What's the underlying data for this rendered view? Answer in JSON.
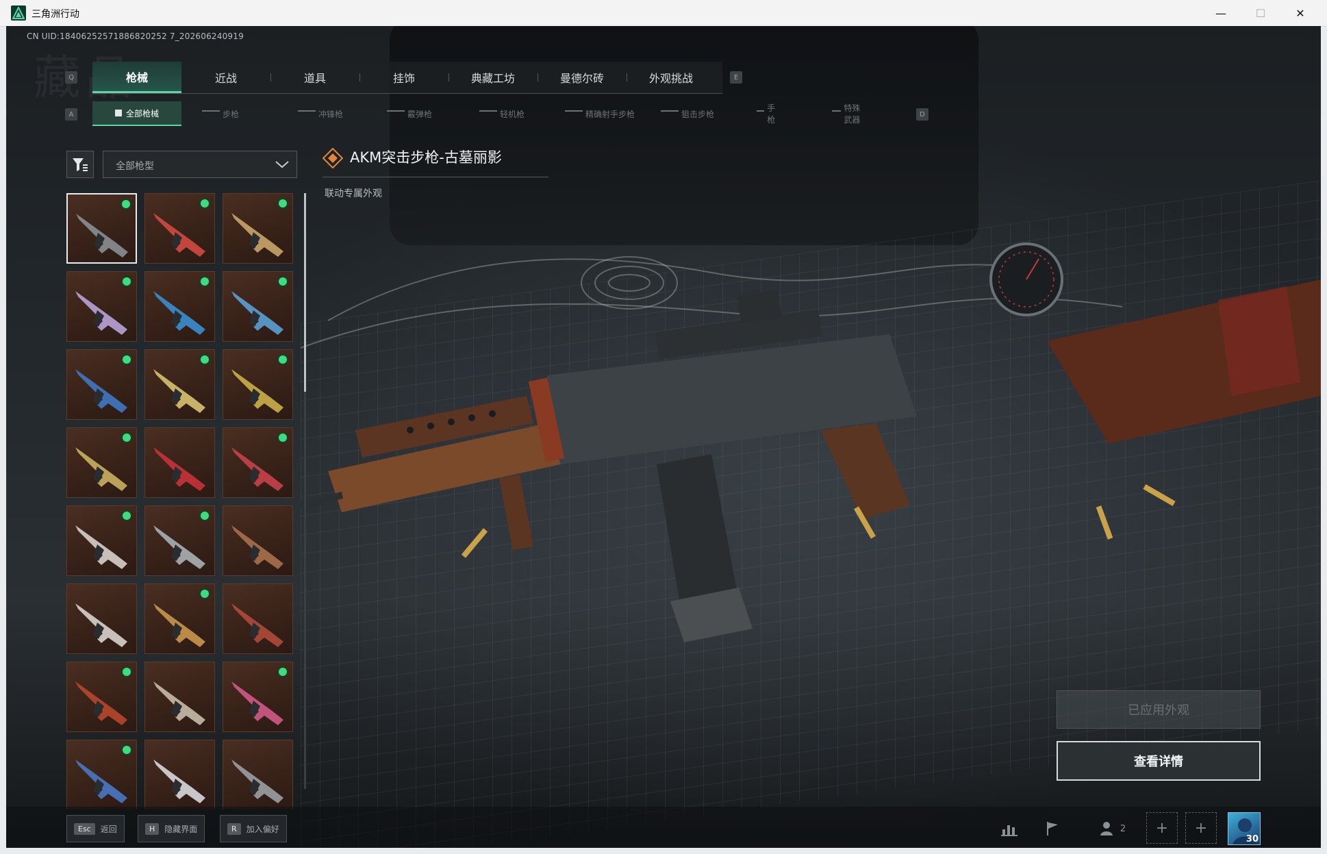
{
  "window": {
    "title": "三角洲行动",
    "min_glyph": "—",
    "max_glyph": "☐",
    "close_glyph": "✕"
  },
  "uid": "CN UID:18406252571886820252 7_202606240919",
  "key_hints": {
    "tab_left": "Q",
    "tab_right": "E",
    "subtab_left": "A",
    "subtab_right": "D"
  },
  "tabs": [
    {
      "label": "枪械",
      "active": true
    },
    {
      "label": "近战"
    },
    {
      "label": "道具"
    },
    {
      "label": "挂饰"
    },
    {
      "label": "典藏工坊"
    },
    {
      "label": "曼德尔砖"
    },
    {
      "label": "外观挑战"
    }
  ],
  "subtabs": [
    {
      "label": "全部枪械",
      "active": true
    },
    {
      "label": "步枪"
    },
    {
      "label": "冲锋枪"
    },
    {
      "label": "霰弹枪"
    },
    {
      "label": "轻机枪"
    },
    {
      "label": "精确射手步枪"
    },
    {
      "label": "狙击步枪"
    },
    {
      "label": "手枪"
    },
    {
      "label": "特殊武器"
    }
  ],
  "filter": {
    "dropdown_label": "全部枪型"
  },
  "grid_items": [
    {
      "owned": true,
      "selected": true,
      "tone": "#8a8f94"
    },
    {
      "owned": true,
      "tone": "#d24a3f"
    },
    {
      "owned": true,
      "tone": "#c9a56a"
    },
    {
      "owned": true,
      "tone": "#b8a3d8"
    },
    {
      "owned": true,
      "tone": "#3a8fd0"
    },
    {
      "owned": true,
      "tone": "#5aa0d6"
    },
    {
      "owned": true,
      "tone": "#3f78c4"
    },
    {
      "owned": true,
      "tone": "#d7c270"
    },
    {
      "owned": true,
      "tone": "#cbb04a"
    },
    {
      "owned": true,
      "tone": "#c9b060"
    },
    {
      "owned": false,
      "tone": "#c8323a"
    },
    {
      "owned": true,
      "tone": "#c8424a"
    },
    {
      "owned": true,
      "tone": "#d8d0cc"
    },
    {
      "owned": true,
      "tone": "#aab0b4"
    },
    {
      "owned": false,
      "tone": "#a8704e"
    },
    {
      "owned": false,
      "tone": "#d8d2cc"
    },
    {
      "owned": true,
      "tone": "#c9974e"
    },
    {
      "owned": false,
      "tone": "#b04a3a"
    },
    {
      "owned": true,
      "tone": "#b8472e"
    },
    {
      "owned": false,
      "tone": "#c9bba8"
    },
    {
      "owned": true,
      "tone": "#d25a86"
    },
    {
      "owned": true,
      "tone": "#4a78c4"
    },
    {
      "owned": false,
      "tone": "#d8d8dc"
    },
    {
      "owned": false,
      "tone": "#9a9ea2"
    }
  ],
  "item": {
    "title": "AKM突击步枪-古墓丽影",
    "subtitle": "联动专属外观"
  },
  "buttons": {
    "applied": "已应用外观",
    "detail": "查看详情"
  },
  "bottom_hints": [
    {
      "key": "Esc",
      "label": "返回"
    },
    {
      "key": "H",
      "label": "隐藏界面"
    },
    {
      "key": "R",
      "label": "加入偏好"
    }
  ],
  "party_count": "2",
  "plus_glyph": "+",
  "player_level": "30",
  "colors": {
    "accent": "#5fd3a9",
    "owned_dot": "#3fdc7e",
    "tab_active_bg": "#26554a"
  }
}
